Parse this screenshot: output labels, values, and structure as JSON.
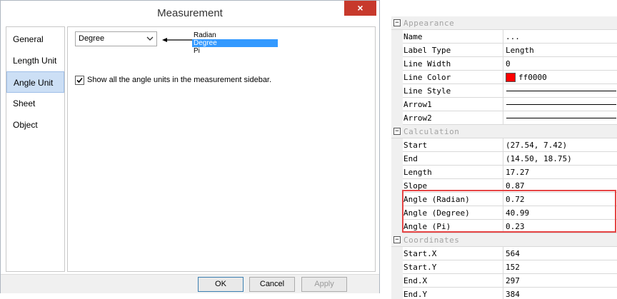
{
  "dialog": {
    "title": "Measurement",
    "close_label": "×",
    "sidebar": [
      {
        "label": "General"
      },
      {
        "label": "Length Unit"
      },
      {
        "label": "Angle Unit",
        "active": true
      },
      {
        "label": "Sheet"
      },
      {
        "label": "Object"
      }
    ],
    "angle_unit": {
      "selected": "Degree",
      "options": [
        "Radian",
        "Degree",
        "Pi"
      ],
      "highlighted_option": "Degree",
      "checkbox_checked": true,
      "checkbox_label": "Show all the angle units in the measurement sidebar."
    },
    "buttons": {
      "ok": "OK",
      "cancel": "Cancel",
      "apply": "Apply"
    }
  },
  "property_grid": {
    "sections": [
      {
        "label": "Appearance",
        "rows": [
          {
            "name": "Name",
            "value": "..."
          },
          {
            "name": "Label Type",
            "value": "Length"
          },
          {
            "name": "Line Width",
            "value": "0"
          },
          {
            "name": "Line Color",
            "value": "ff0000",
            "swatch": "#ff0000"
          },
          {
            "name": "Line Style",
            "value": "",
            "line": true
          },
          {
            "name": "Arrow1",
            "value": "",
            "line": true
          },
          {
            "name": "Arrow2",
            "value": "",
            "line": true
          }
        ]
      },
      {
        "label": "Calculation",
        "rows": [
          {
            "name": "Start",
            "value": "(27.54, 7.42)"
          },
          {
            "name": "End",
            "value": "(14.50, 18.75)"
          },
          {
            "name": "Length",
            "value": "17.27"
          },
          {
            "name": "Slope",
            "value": "0.87"
          },
          {
            "name": "Angle (Radian)",
            "value": "0.72"
          },
          {
            "name": "Angle (Degree)",
            "value": "40.99"
          },
          {
            "name": "Angle (Pi)",
            "value": "0.23"
          }
        ]
      },
      {
        "label": "Coordinates",
        "rows": [
          {
            "name": "Start.X",
            "value": "564"
          },
          {
            "name": "Start.Y",
            "value": "152"
          },
          {
            "name": "End.X",
            "value": "297"
          },
          {
            "name": "End.Y",
            "value": "384"
          }
        ]
      }
    ]
  },
  "colors": {
    "close_button": "#c7392c",
    "highlight": "#e64545",
    "selection": "#3399ff",
    "active_tab": "#ccdff5"
  }
}
